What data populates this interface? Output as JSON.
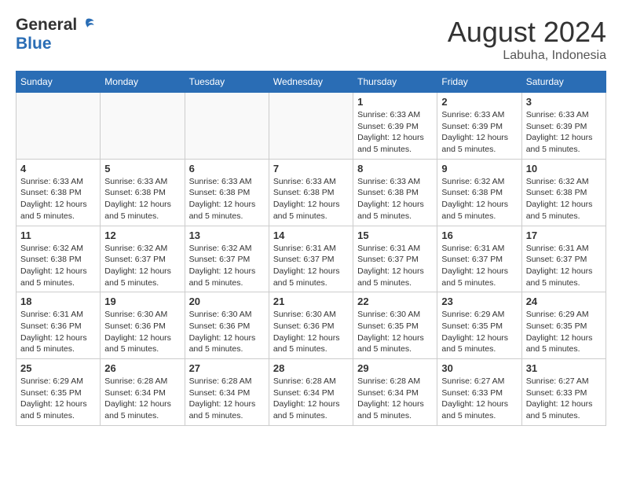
{
  "header": {
    "logo_general": "General",
    "logo_blue": "Blue",
    "month": "August 2024",
    "location": "Labuha, Indonesia"
  },
  "weekdays": [
    "Sunday",
    "Monday",
    "Tuesday",
    "Wednesday",
    "Thursday",
    "Friday",
    "Saturday"
  ],
  "weeks": [
    [
      {
        "day": "",
        "info": ""
      },
      {
        "day": "",
        "info": ""
      },
      {
        "day": "",
        "info": ""
      },
      {
        "day": "",
        "info": ""
      },
      {
        "day": "1",
        "info": "Sunrise: 6:33 AM\nSunset: 6:39 PM\nDaylight: 12 hours\nand 5 minutes."
      },
      {
        "day": "2",
        "info": "Sunrise: 6:33 AM\nSunset: 6:39 PM\nDaylight: 12 hours\nand 5 minutes."
      },
      {
        "day": "3",
        "info": "Sunrise: 6:33 AM\nSunset: 6:39 PM\nDaylight: 12 hours\nand 5 minutes."
      }
    ],
    [
      {
        "day": "4",
        "info": "Sunrise: 6:33 AM\nSunset: 6:38 PM\nDaylight: 12 hours\nand 5 minutes."
      },
      {
        "day": "5",
        "info": "Sunrise: 6:33 AM\nSunset: 6:38 PM\nDaylight: 12 hours\nand 5 minutes."
      },
      {
        "day": "6",
        "info": "Sunrise: 6:33 AM\nSunset: 6:38 PM\nDaylight: 12 hours\nand 5 minutes."
      },
      {
        "day": "7",
        "info": "Sunrise: 6:33 AM\nSunset: 6:38 PM\nDaylight: 12 hours\nand 5 minutes."
      },
      {
        "day": "8",
        "info": "Sunrise: 6:33 AM\nSunset: 6:38 PM\nDaylight: 12 hours\nand 5 minutes."
      },
      {
        "day": "9",
        "info": "Sunrise: 6:32 AM\nSunset: 6:38 PM\nDaylight: 12 hours\nand 5 minutes."
      },
      {
        "day": "10",
        "info": "Sunrise: 6:32 AM\nSunset: 6:38 PM\nDaylight: 12 hours\nand 5 minutes."
      }
    ],
    [
      {
        "day": "11",
        "info": "Sunrise: 6:32 AM\nSunset: 6:38 PM\nDaylight: 12 hours\nand 5 minutes."
      },
      {
        "day": "12",
        "info": "Sunrise: 6:32 AM\nSunset: 6:37 PM\nDaylight: 12 hours\nand 5 minutes."
      },
      {
        "day": "13",
        "info": "Sunrise: 6:32 AM\nSunset: 6:37 PM\nDaylight: 12 hours\nand 5 minutes."
      },
      {
        "day": "14",
        "info": "Sunrise: 6:31 AM\nSunset: 6:37 PM\nDaylight: 12 hours\nand 5 minutes."
      },
      {
        "day": "15",
        "info": "Sunrise: 6:31 AM\nSunset: 6:37 PM\nDaylight: 12 hours\nand 5 minutes."
      },
      {
        "day": "16",
        "info": "Sunrise: 6:31 AM\nSunset: 6:37 PM\nDaylight: 12 hours\nand 5 minutes."
      },
      {
        "day": "17",
        "info": "Sunrise: 6:31 AM\nSunset: 6:37 PM\nDaylight: 12 hours\nand 5 minutes."
      }
    ],
    [
      {
        "day": "18",
        "info": "Sunrise: 6:31 AM\nSunset: 6:36 PM\nDaylight: 12 hours\nand 5 minutes."
      },
      {
        "day": "19",
        "info": "Sunrise: 6:30 AM\nSunset: 6:36 PM\nDaylight: 12 hours\nand 5 minutes."
      },
      {
        "day": "20",
        "info": "Sunrise: 6:30 AM\nSunset: 6:36 PM\nDaylight: 12 hours\nand 5 minutes."
      },
      {
        "day": "21",
        "info": "Sunrise: 6:30 AM\nSunset: 6:36 PM\nDaylight: 12 hours\nand 5 minutes."
      },
      {
        "day": "22",
        "info": "Sunrise: 6:30 AM\nSunset: 6:35 PM\nDaylight: 12 hours\nand 5 minutes."
      },
      {
        "day": "23",
        "info": "Sunrise: 6:29 AM\nSunset: 6:35 PM\nDaylight: 12 hours\nand 5 minutes."
      },
      {
        "day": "24",
        "info": "Sunrise: 6:29 AM\nSunset: 6:35 PM\nDaylight: 12 hours\nand 5 minutes."
      }
    ],
    [
      {
        "day": "25",
        "info": "Sunrise: 6:29 AM\nSunset: 6:35 PM\nDaylight: 12 hours\nand 5 minutes."
      },
      {
        "day": "26",
        "info": "Sunrise: 6:28 AM\nSunset: 6:34 PM\nDaylight: 12 hours\nand 5 minutes."
      },
      {
        "day": "27",
        "info": "Sunrise: 6:28 AM\nSunset: 6:34 PM\nDaylight: 12 hours\nand 5 minutes."
      },
      {
        "day": "28",
        "info": "Sunrise: 6:28 AM\nSunset: 6:34 PM\nDaylight: 12 hours\nand 5 minutes."
      },
      {
        "day": "29",
        "info": "Sunrise: 6:28 AM\nSunset: 6:34 PM\nDaylight: 12 hours\nand 5 minutes."
      },
      {
        "day": "30",
        "info": "Sunrise: 6:27 AM\nSunset: 6:33 PM\nDaylight: 12 hours\nand 5 minutes."
      },
      {
        "day": "31",
        "info": "Sunrise: 6:27 AM\nSunset: 6:33 PM\nDaylight: 12 hours\nand 5 minutes."
      }
    ]
  ]
}
